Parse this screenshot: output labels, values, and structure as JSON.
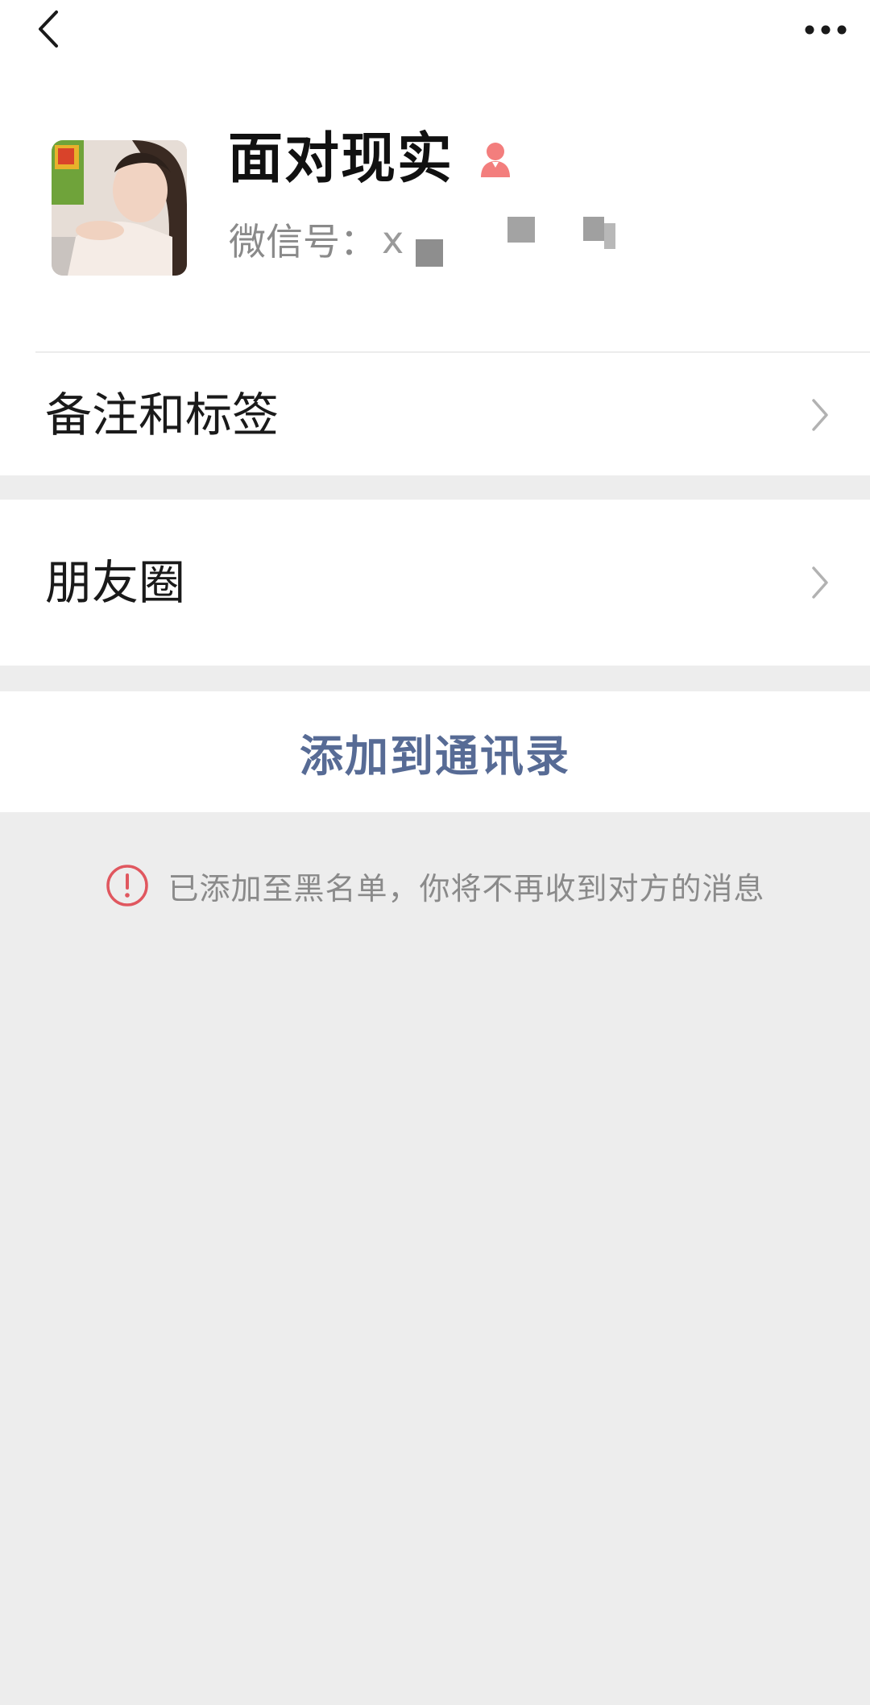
{
  "nav": {
    "back_icon": "chevron-left-icon",
    "more_icon": "more-dots-icon"
  },
  "profile": {
    "name": "面对现实",
    "gender_icon": "female-icon",
    "gender_color": "#f37e7d",
    "wechat_label": "微信号：",
    "wechat_value_visible": "x"
  },
  "cells": {
    "remark_label": "备注和标签",
    "moments_label": "朋友圈"
  },
  "actions": {
    "add_to_contacts": "添加到通讯录",
    "link_color": "#576b95"
  },
  "notice": {
    "icon": "alert-circle-icon",
    "icon_color": "#e0575f",
    "text": "已添加至黑名单，你将不再收到对方的消息"
  }
}
